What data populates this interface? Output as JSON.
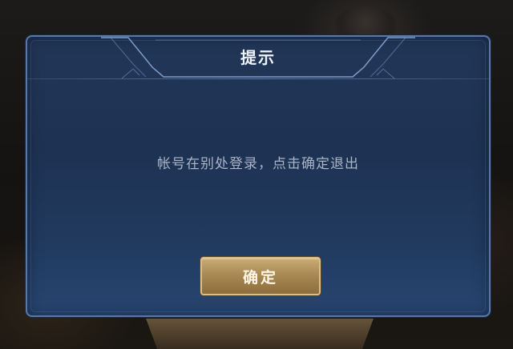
{
  "dialog": {
    "title": "提示",
    "message": "帐号在别处登录，点击确定退出",
    "confirm_label": "确定"
  },
  "colors": {
    "panel": "#223657",
    "panel_border": "#5a78a6",
    "title_text": "#eef3fb",
    "message_text": "#a9b4c6",
    "button_gold": "#b4955f",
    "button_border": "#d9c08a"
  }
}
